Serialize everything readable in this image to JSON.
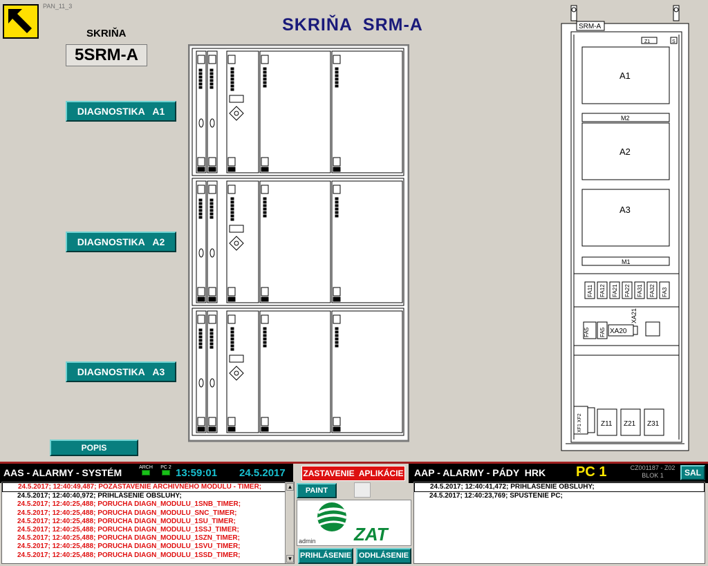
{
  "page_id": "PAN_11_3",
  "title": "SKRIŇA  SRM-A",
  "cabinet": {
    "label": "SKRIŇA",
    "name": "5SRM-A"
  },
  "diag_buttons": [
    "DIAGNOSTIKA   A1",
    "DIAGNOSTIKA   A2",
    "DIAGNOSTIKA   A3"
  ],
  "popis_label": "POPIS",
  "cabinet_drawing": {
    "tag": "SRM-A",
    "corner_tag": "Z1",
    "corner_tag2": "S",
    "module_a1": "A1",
    "rail_m2": "M2",
    "module_a2": "A2",
    "module_a3": "A3",
    "rail_m1": "M1",
    "fuses": [
      "FA11",
      "FA12",
      "FA21",
      "FA22",
      "FA31",
      "FA32",
      "FA3"
    ],
    "fa5a": "FA5",
    "fa5b": "FA5",
    "xa20": "XA20",
    "xa21": "XA21",
    "side_label": "XF1 XF2",
    "psu": [
      "Z11",
      "Z21",
      "Z31"
    ]
  },
  "bottom_bar": {
    "aas_title": "AAS - ALARMY - SYSTÉM",
    "arch_label": "ARCH",
    "pc2_label": "PC 2",
    "time": "13:59:01",
    "date": "24.5.2017",
    "stop_label": "ZASTAVENIE  APLIKÁCIE",
    "aap_title": "AAP - ALARMY - PÁDY  HRK",
    "pc_label": "PC 1",
    "code": "CZ001187 - Z02",
    "blok": "BLOK 1",
    "sal_label": "SAL",
    "paint_label": "PAINT",
    "logo_text": "ZAT",
    "user": "admin",
    "login_label": "PRIHLÁSENIE",
    "logout_label": "ODHLÁSENIE"
  },
  "colors": {
    "teal": "#087f7f",
    "alarm_red": "#e01010",
    "clock": "#18c0d0",
    "pc_yellow": "#ffe800",
    "bar_bg": "#000000",
    "logo_green": "#0c8a3a"
  },
  "aas_log": [
    {
      "text": "24.5.2017; 12:40:49,487; POZASTAVENIE ARCHIVNÉHO MODULU - TIMER;",
      "color": "red"
    },
    {
      "text": "24.5.2017; 12:40:40,972; PRIHLÁSENIE OBSLUHY;",
      "color": "black"
    },
    {
      "text": "24.5.2017; 12:40:25,488; PORUCHA DIAGN_MODULU_1SNB_TIMER;",
      "color": "red"
    },
    {
      "text": "24.5.2017; 12:40:25,488; PORUCHA DIAGN_MODULU_SNC_TIMER;",
      "color": "red"
    },
    {
      "text": "24.5.2017; 12:40:25,488; PORUCHA DIAGN_MODULU_1SU_TIMER;",
      "color": "red"
    },
    {
      "text": "24.5.2017; 12:40:25,488; PORUCHA DIAGN_MODULU_1SSJ_TIMER;",
      "color": "red"
    },
    {
      "text": "24.5.2017; 12:40:25,488; PORUCHA DIAGN_MODULU_1SZN_TIMER;",
      "color": "red"
    },
    {
      "text": "24.5.2017; 12:40:25,488; PORUCHA DIAGN_MODULU_1SVU_TIMER;",
      "color": "red"
    },
    {
      "text": "24.5.2017; 12:40:25,488; PORUCHA DIAGN_MODULU_1SSD_TIMER;",
      "color": "red"
    }
  ],
  "aap_log": [
    {
      "text": "24.5.2017; 12:40:41,472; PRIHLÁSENIE OBSLUHY;",
      "color": "black"
    },
    {
      "text": "24.5.2017; 12:40:23,769; SPUSTENIE PC;",
      "color": "black"
    }
  ]
}
